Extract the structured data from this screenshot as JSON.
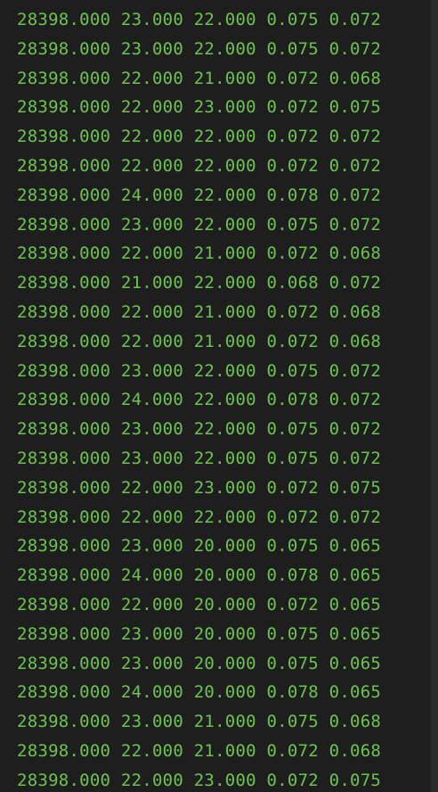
{
  "terminal": {
    "lines": [
      "28398.000 23.000 22.000 0.075 0.072",
      "28398.000 23.000 22.000 0.075 0.072",
      "28398.000 22.000 21.000 0.072 0.068",
      "28398.000 22.000 23.000 0.072 0.075",
      "28398.000 22.000 22.000 0.072 0.072",
      "28398.000 22.000 22.000 0.072 0.072",
      "28398.000 24.000 22.000 0.078 0.072",
      "28398.000 23.000 22.000 0.075 0.072",
      "28398.000 22.000 21.000 0.072 0.068",
      "28398.000 21.000 22.000 0.068 0.072",
      "28398.000 22.000 21.000 0.072 0.068",
      "28398.000 22.000 21.000 0.072 0.068",
      "28398.000 23.000 22.000 0.075 0.072",
      "28398.000 24.000 22.000 0.078 0.072",
      "28398.000 23.000 22.000 0.075 0.072",
      "28398.000 23.000 22.000 0.075 0.072",
      "28398.000 22.000 23.000 0.072 0.075",
      "28398.000 22.000 22.000 0.072 0.072",
      "28398.000 23.000 20.000 0.075 0.065",
      "28398.000 24.000 20.000 0.078 0.065",
      "28398.000 22.000 20.000 0.072 0.065",
      "28398.000 23.000 20.000 0.075 0.065",
      "28398.000 23.000 20.000 0.075 0.065",
      "28398.000 24.000 20.000 0.078 0.065",
      "28398.000 23.000 21.000 0.075 0.068",
      "28398.000 22.000 21.000 0.072 0.068",
      "28398.000 22.000 23.000 0.072 0.075"
    ]
  },
  "colors": {
    "background": "#1e1e1e",
    "text": "#6cc34f"
  }
}
